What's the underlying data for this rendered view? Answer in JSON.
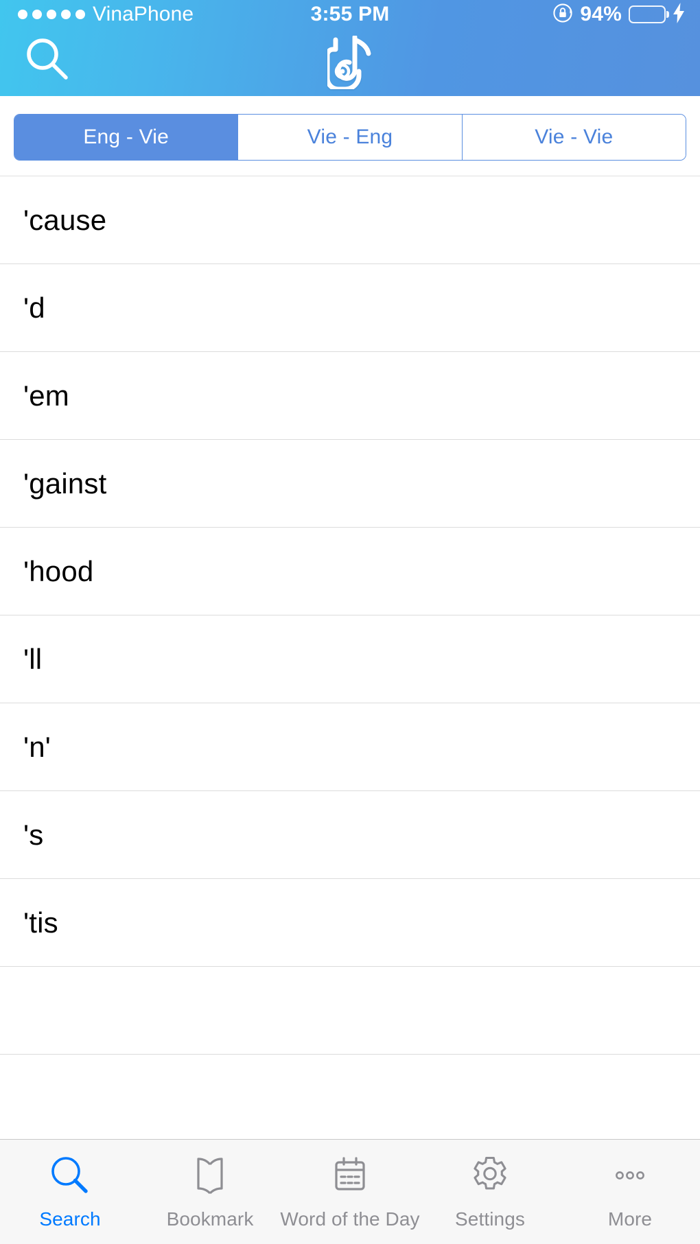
{
  "status_bar": {
    "carrier": "VinaPhone",
    "signal_dots": 5,
    "time": "3:55 PM",
    "battery_percent": "94%",
    "battery_level": 94,
    "battery_color": "#4CD364",
    "rotation_lock_icon": "rotation-lock-icon",
    "charging_icon": "lightning-bolt-icon"
  },
  "nav_bar": {
    "search_icon": "search-icon",
    "logo_icon": "app-logo-icon",
    "gradient_start": "#41c6ee",
    "gradient_end": "#5691de"
  },
  "segmented_control": {
    "selected_index": 0,
    "accent_color": "#5a8ee0",
    "segments": [
      {
        "label": "Eng - Vie",
        "selected": true
      },
      {
        "label": "Vie - Eng",
        "selected": false
      },
      {
        "label": "Vie - Vie",
        "selected": false
      }
    ]
  },
  "word_list": {
    "items": [
      {
        "word": "'cause"
      },
      {
        "word": "'d"
      },
      {
        "word": "'em"
      },
      {
        "word": "'gainst"
      },
      {
        "word": "'hood"
      },
      {
        "word": "'ll"
      },
      {
        "word": "'n'"
      },
      {
        "word": "'s"
      },
      {
        "word": "'tis"
      }
    ]
  },
  "tab_bar": {
    "active_index": 0,
    "active_color": "#007AFF",
    "inactive_color": "#8e8e93",
    "tabs": [
      {
        "label": "Search",
        "icon": "search-icon",
        "active": true
      },
      {
        "label": "Bookmark",
        "icon": "open-book-icon",
        "active": false
      },
      {
        "label": "Word of the Day",
        "icon": "calendar-icon",
        "active": false
      },
      {
        "label": "Settings",
        "icon": "gear-icon",
        "active": false
      },
      {
        "label": "More",
        "icon": "ellipsis-icon",
        "active": false
      }
    ]
  }
}
